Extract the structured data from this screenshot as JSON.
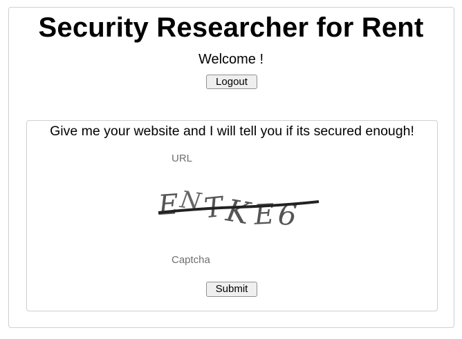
{
  "header": {
    "title": "Security Researcher for Rent",
    "welcome": "Welcome !",
    "logout_label": "Logout"
  },
  "form": {
    "prompt": "Give me your website and I will tell you if its secured enough!",
    "url_label": "URL",
    "captcha_label": "Captcha",
    "captcha_text": "ENTKE6",
    "submit_label": "Submit"
  }
}
